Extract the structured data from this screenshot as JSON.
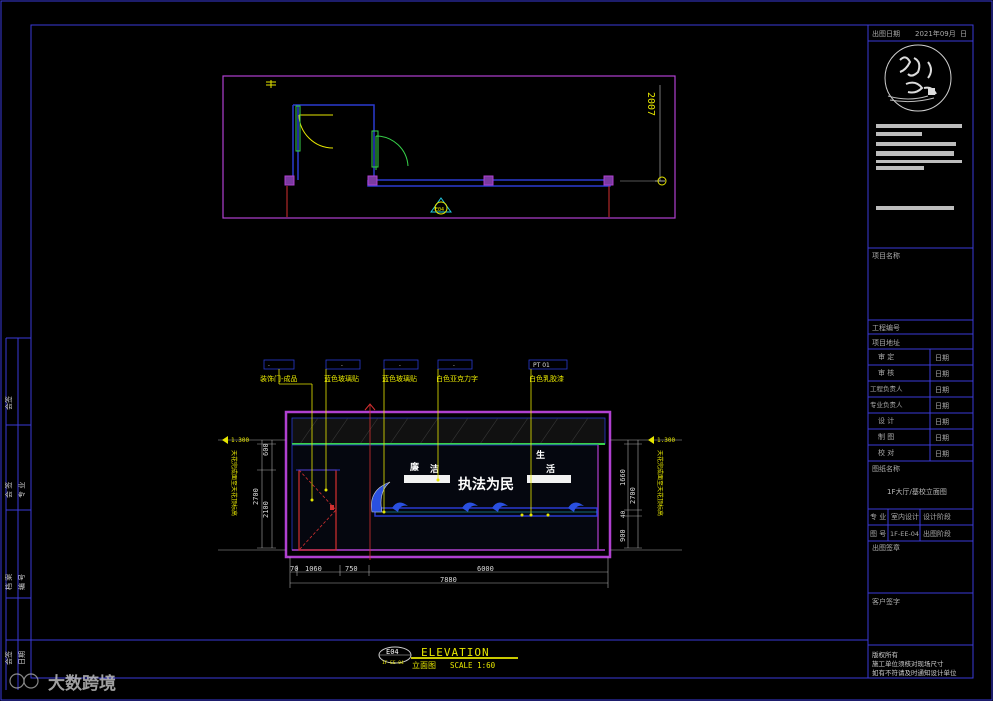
{
  "title_block": {
    "date_label": "出图日期",
    "date_value": "2021年09月",
    "date_suffix": "日",
    "project_name_label": "项目名称",
    "project_no_label": "工程编号",
    "project_addr_label": "项目地址",
    "approve_label": "审 定",
    "review_label": "审 核",
    "engineer_label": "工程负责人",
    "pro_engineer_label": "专业负责人",
    "design_label": "设 计",
    "draw_label": "制 图",
    "check_label": "校 对",
    "date_col": "日期",
    "drawing_name_label": "图纸名称",
    "drawing_name_value": "1F大厅/基校立面图",
    "discipline_label": "专 业",
    "discipline_value": "室内设计",
    "stage_value": "设计阶段",
    "sheet_no_label": "图 号",
    "sheet_no_value": "1F-EE-04",
    "stage_label": "出图阶段",
    "seal_label": "出图签章",
    "client_label": "客户签字",
    "rights_1": "版权所有",
    "rights_2": "施工单位须核对现场尺寸",
    "rights_3": "如有不符请及时通知设计单位"
  },
  "left_strip": {
    "row1": "会签",
    "row2a": "会 签",
    "row2b": "专 业",
    "row3a": "档 案",
    "row3b": "编 号",
    "row4a": "会签",
    "row4b": "日期"
  },
  "plan": {
    "dimension": "2007",
    "index_label": "E04"
  },
  "elevation": {
    "callouts": [
      "装饰门-成品",
      "蓝色玻璃贴",
      "蓝色玻璃贴",
      "白色亚克力字",
      "白色乳胶漆"
    ],
    "callout_tags": [
      "-",
      "-",
      "-",
      "-",
      "PT 01"
    ],
    "slogan": "执法为民",
    "char_left": "廉",
    "char_left2": "洁",
    "char_right": "生",
    "char_right2": "活",
    "dims_bottom": [
      "70",
      "1060",
      "750",
      "6000"
    ],
    "dim_total": "7880",
    "dims_left": [
      "600",
      "2700",
      "2100"
    ],
    "dims_right": [
      "1660",
      "2700",
      "40",
      "900"
    ],
    "level_label_left": "1.300",
    "level_label_right": "1.300",
    "vertical_note_left": "天花完成面至天花顶标高",
    "vertical_note_right": "天花完成面至天花顶标高"
  },
  "caption": {
    "index": "E04",
    "sub_index": "1F-EE-04",
    "title_en": "ELEVATION",
    "title_cn": "立面图",
    "scale": "SCALE 1:60"
  },
  "watermark": {
    "brand": "大数跨境"
  },
  "colors": {
    "frame": "#3a3ad8",
    "magenta": "#b040d0",
    "yellow": "#e6e600",
    "cyan": "#22c8e0",
    "green": "#37d24a",
    "red": "#d43030",
    "blue_wall": "#2a3ad0"
  }
}
